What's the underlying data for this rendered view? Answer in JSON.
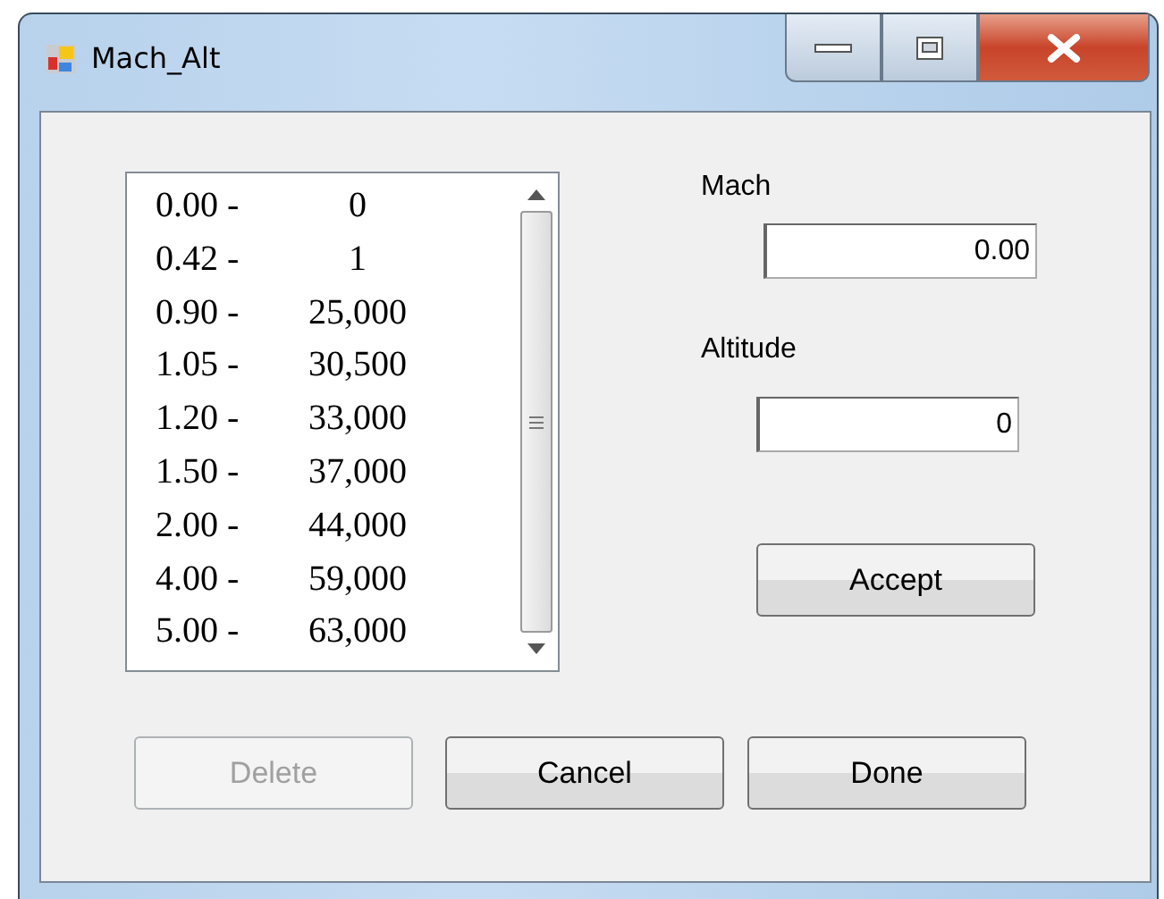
{
  "window": {
    "title": "Mach_Alt"
  },
  "list": {
    "items": [
      {
        "mach": "0.00 -",
        "altitude": "0",
        "selected": false
      },
      {
        "mach": "0.42 -",
        "altitude": "1",
        "selected": false
      },
      {
        "mach": "0.90 -",
        "altitude": "25,000",
        "selected": false
      },
      {
        "mach": "1.05 -",
        "altitude": "30,500",
        "selected": false
      },
      {
        "mach": "1.20 -",
        "altitude": "33,000",
        "selected": false
      },
      {
        "mach": "1.50 -",
        "altitude": "37,000",
        "selected": false
      },
      {
        "mach": "2.00 -",
        "altitude": "44,000",
        "selected": false
      },
      {
        "mach": "4.00 -",
        "altitude": "59,000",
        "selected": false
      },
      {
        "mach": "5.00 -",
        "altitude": "63,000",
        "selected": false
      }
    ]
  },
  "mach": {
    "label": "Mach",
    "value": "0.00"
  },
  "altitude": {
    "label": "Altitude",
    "value": "0"
  },
  "accept_button": {
    "label": "Accept",
    "disabled": false
  },
  "buttons": [
    {
      "label": "Delete",
      "disabled": true
    },
    {
      "label": "Cancel",
      "disabled": false
    },
    {
      "label": "Done",
      "disabled": false
    }
  ]
}
